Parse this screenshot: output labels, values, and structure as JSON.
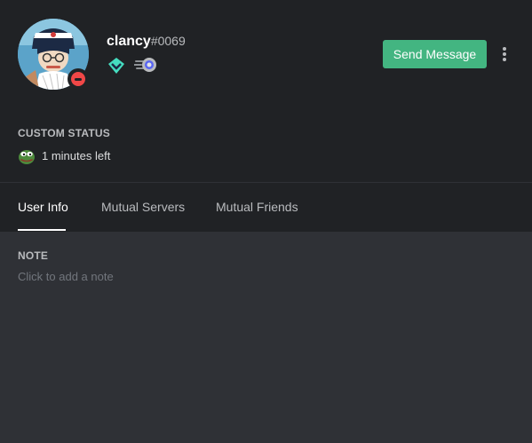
{
  "user": {
    "username": "clancy",
    "discriminator": "#0069",
    "status": "do-not-disturb",
    "avatar": "avatar-image"
  },
  "badges": [
    {
      "name": "hypesquad-balance-icon",
      "color": "#45ddc0"
    },
    {
      "name": "nitro-boost-icon",
      "color": "#b9bbbe"
    }
  ],
  "actions": {
    "send_message_label": "Send Message",
    "more_icon": "more-vertical-icon"
  },
  "custom_status": {
    "title": "CUSTOM STATUS",
    "emoji": "pepe-emoji",
    "text": "1 minutes left"
  },
  "tabs": [
    {
      "label": "User Info",
      "active": true
    },
    {
      "label": "Mutual Servers",
      "active": false
    },
    {
      "label": "Mutual Friends",
      "active": false
    }
  ],
  "note": {
    "title": "NOTE",
    "placeholder": "Click to add a note",
    "value": ""
  },
  "colors": {
    "header_bg": "#202225",
    "body_bg": "#2f3136",
    "send_button": "#43b581",
    "dnd_status": "#f04747",
    "hypesquad_balance": "#45ddc0"
  }
}
